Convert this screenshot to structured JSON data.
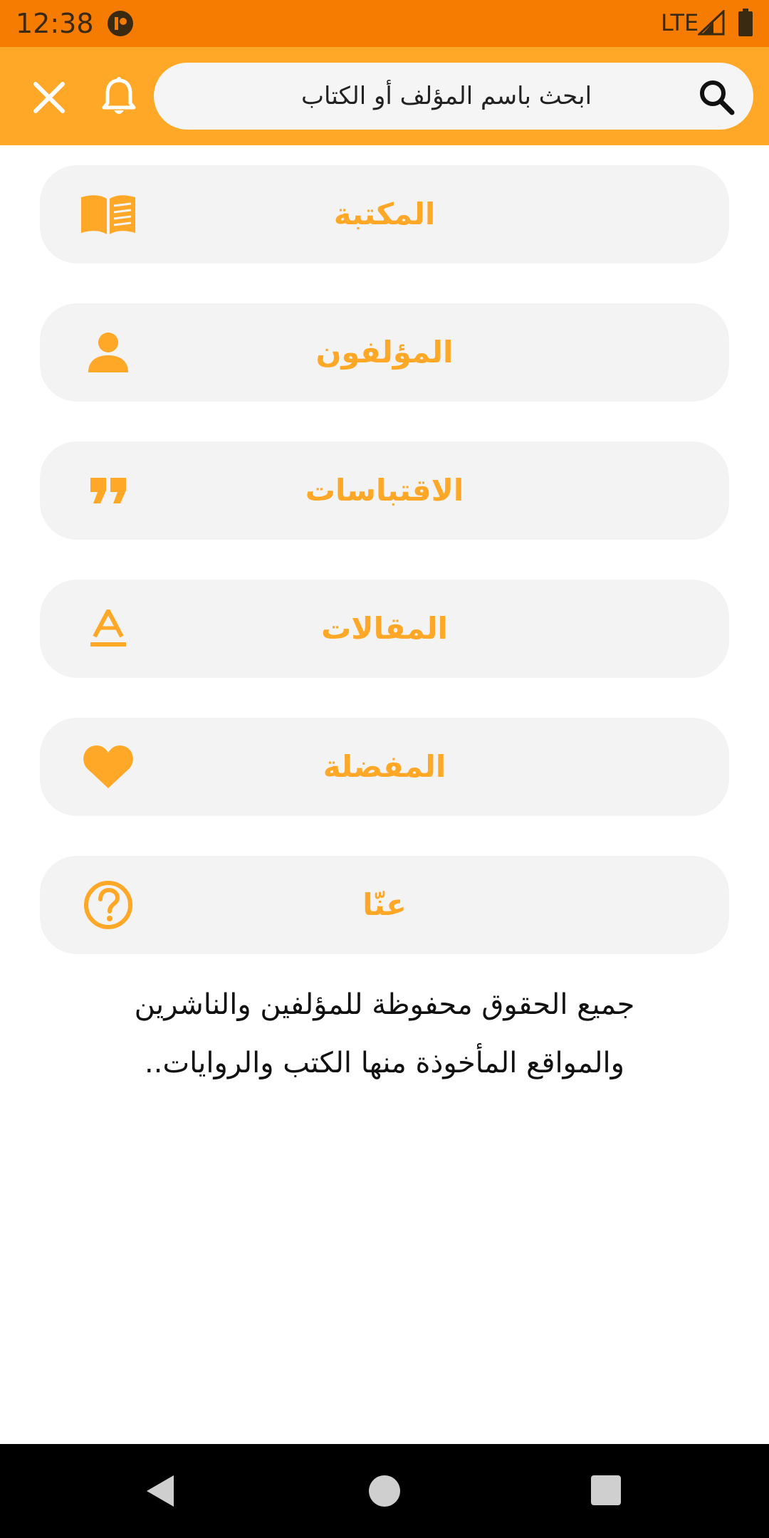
{
  "status_bar": {
    "time": "12:38",
    "network": "LTE"
  },
  "app_bar": {
    "search_placeholder": "ابحث باسم المؤلف أو الكتاب"
  },
  "menu": {
    "items": [
      {
        "label": "المكتبة",
        "icon": "book-icon"
      },
      {
        "label": "المؤلفون",
        "icon": "person-icon"
      },
      {
        "label": "الاقتباسات",
        "icon": "quote-icon"
      },
      {
        "label": "المقالات",
        "icon": "text-format-icon"
      },
      {
        "label": "المفضلة",
        "icon": "heart-icon"
      },
      {
        "label": "عنّا",
        "icon": "help-circle-icon"
      }
    ]
  },
  "footer": {
    "line1": "جميع الحقوق محفوظة للمؤلفين والناشرين",
    "line2": "والمواقع المأخوذة منها الكتب والروايات.."
  },
  "colors": {
    "status_bar": "#f57c00",
    "app_bar": "#ffa726",
    "accent": "#ffa726",
    "menu_bg": "#f3f3f3"
  }
}
